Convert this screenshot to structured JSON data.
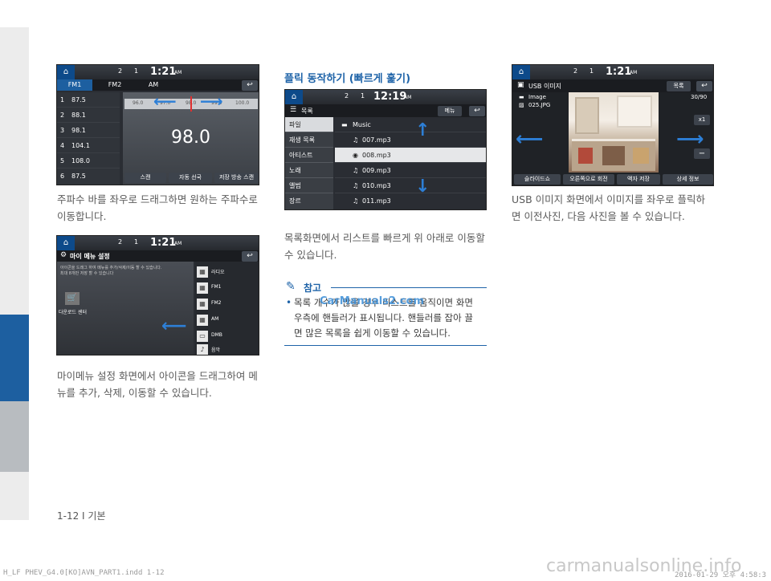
{
  "page_marker": "1-12 I 기본",
  "footer": {
    "file": "H_LF PHEV_G4.0[KO]AVN_PART1.indd   1-12",
    "date": "2016-01-29   오후 4:58:3",
    "watermark": "carmanualsonline.info",
    "overlay": "CarManuals2.com"
  },
  "col1": {
    "radio": {
      "status": {
        "ch2": "2",
        "ch1": "1",
        "time": "1:21",
        "ampm": "AM"
      },
      "bands": [
        "FM1",
        "FM2",
        "AM"
      ],
      "presets": [
        {
          "num": "1",
          "freq": "87.5"
        },
        {
          "num": "2",
          "freq": "88.1"
        },
        {
          "num": "3",
          "freq": "98.1"
        },
        {
          "num": "4",
          "freq": "104.1"
        },
        {
          "num": "5",
          "freq": "108.0"
        },
        {
          "num": "6",
          "freq": "87.5"
        }
      ],
      "scale": [
        "96.0",
        "97.0",
        "98.0",
        "99.0",
        "100.0"
      ],
      "freq": "98.0",
      "buttons": [
        "스캔",
        "자동 선국",
        "저장 방송 스캔"
      ]
    },
    "radio_caption": [
      "주파수 바를 좌우로 드래그하면 원하는 주파수로",
      "이동합니다."
    ],
    "mymenu": {
      "status": {
        "ch2": "2",
        "ch1": "1",
        "time": "1:21",
        "ampm": "AM"
      },
      "title": "마이 메뉴 설정",
      "desc": [
        "아이콘을 드래그 하여 메뉴를 추가/삭제/이동 할 수 있습니다.",
        "최대 8개만 저장 할 수 있습니다"
      ],
      "download_label": "다운로드 센터",
      "items": [
        "라디오",
        "FM1",
        "FM2",
        "AM",
        "DMB",
        "음악"
      ]
    },
    "mymenu_caption": [
      "마이메뉴 설정 화면에서 아이콘을 드래그하여 메",
      "뉴를 추가, 삭제, 이동할 수 있습니다."
    ]
  },
  "col2": {
    "heading": "플릭 동작하기 (빠르게 훑기)",
    "list": {
      "status": {
        "ch2": "2",
        "ch1": "1",
        "time": "12:19",
        "ampm": "AM"
      },
      "title": "목록",
      "menu_btn": "메뉴",
      "tabs": [
        "파일",
        "재생 목록",
        "아티스트",
        "노래",
        "앨범",
        "장르"
      ],
      "folder": "Music",
      "files": [
        "007.mp3",
        "008.mp3",
        "009.mp3",
        "010.mp3",
        "011.mp3"
      ]
    },
    "caption": [
      "목록화면에서 리스트를 빠르게 위 아래로 이동할",
      "수 있습니다."
    ],
    "note": {
      "title": "참고",
      "bullet": "•",
      "lines": [
        "목록 개수가 많을 경우 리스트를 움직이면 화면",
        "우측에 핸들러가 표시됩니다. 핸들러를 잡아 끌",
        "면 많은 목록을 쉽게 이동할 수 있습니다."
      ]
    }
  },
  "col3": {
    "usb": {
      "status": {
        "ch2": "2",
        "ch1": "1",
        "time": "1:21",
        "ampm": "AM"
      },
      "title": "USB 이미지",
      "list_btn": "목록",
      "counter": "30/90",
      "folder": "Image",
      "file": "025.JPG",
      "zoom": "x1",
      "buttons": [
        "슬라이드쇼",
        "오른쪽으로 회전",
        "액자 저장",
        "상세 정보"
      ]
    },
    "caption": [
      "USB 이미지 화면에서 이미지를 좌우로 플릭하",
      "면 이전사진, 다음 사진을 볼 수 있습니다."
    ]
  }
}
